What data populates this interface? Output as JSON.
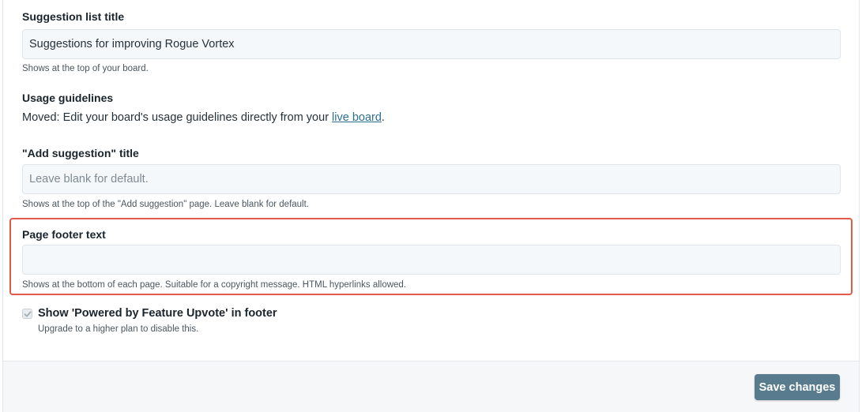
{
  "fields": {
    "suggestion_list_title": {
      "label": "Suggestion list title",
      "value": "Suggestions for improving Rogue Vortex",
      "help": "Shows at the top of your board."
    },
    "usage_guidelines": {
      "label": "Usage guidelines",
      "text_before": "Moved: Edit your board's usage guidelines directly from your ",
      "link": "live board",
      "text_after": "."
    },
    "add_suggestion_title": {
      "label": "\"Add suggestion\" title",
      "value": "",
      "placeholder": "Leave blank for default.",
      "help": "Shows at the top of the \"Add suggestion\" page. Leave blank for default."
    },
    "page_footer_text": {
      "label": "Page footer text",
      "value": "",
      "help": "Shows at the bottom of each page. Suitable for a copyright message. HTML hyperlinks allowed."
    },
    "powered_by": {
      "label": "Show 'Powered by Feature Upvote' in footer",
      "checked": true,
      "disabled": true,
      "help": "Upgrade to a higher plan to disable this."
    }
  },
  "footer": {
    "save_label": "Save changes"
  },
  "colors": {
    "highlight": "#e05a45",
    "button": "#587c8e",
    "link": "#2d6f8e"
  }
}
